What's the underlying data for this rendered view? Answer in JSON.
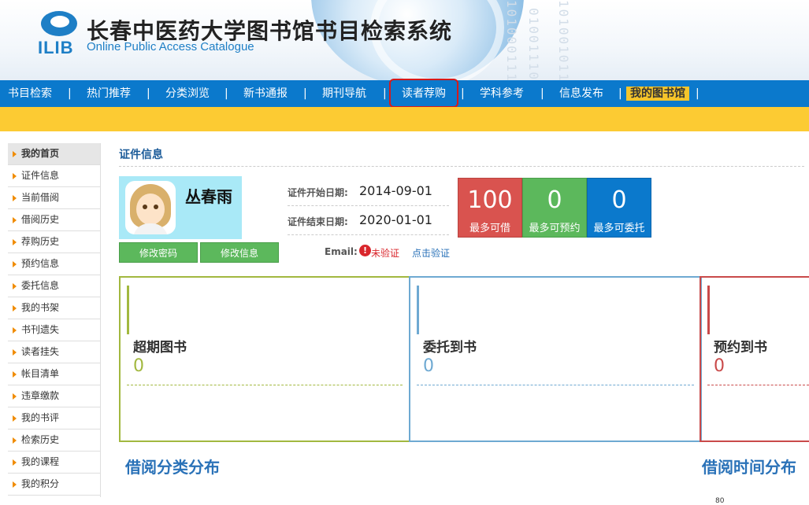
{
  "header": {
    "logo_text": "ILIB",
    "title": "长春中医药大学图书馆书目检索系统",
    "subtitle": "Online Public Access Catalogue"
  },
  "nav": {
    "items": [
      "书目检索",
      "热门推荐",
      "分类浏览",
      "新书通报",
      "期刊导航",
      "读者荐购",
      "学科参考",
      "信息发布",
      "我的图书馆"
    ],
    "separator": "|"
  },
  "sidebar": {
    "items": [
      "我的首页",
      "证件信息",
      "当前借阅",
      "借阅历史",
      "荐购历史",
      "预约信息",
      "委托信息",
      "我的书架",
      "书刊遗失",
      "读者挂失",
      "帐目清单",
      "违章缴款",
      "我的书评",
      "检索历史",
      "我的课程",
      "我的积分"
    ]
  },
  "profile": {
    "section_title": "证件信息",
    "name": "丛春雨",
    "start_label": "证件开始日期:",
    "start_date": "2014-09-01",
    "end_label": "证件结束日期:",
    "end_date": "2020-01-01",
    "change_password": "修改密码",
    "edit_info": "修改信息",
    "email_label": "Email:",
    "email_icon": "!",
    "email_status": "未验证",
    "email_verify": "点击验证"
  },
  "stats": [
    {
      "value": "100",
      "label": "最多可借",
      "color": "#d9534f"
    },
    {
      "value": "0",
      "label": "最多可预约",
      "color": "#5cb85c"
    },
    {
      "value": "0",
      "label": "最多可委托",
      "color": "#0b79cc"
    }
  ],
  "cards": [
    {
      "title": "超期图书",
      "value": "0",
      "color": "#a2b83f"
    },
    {
      "title": "委托到书",
      "value": "0",
      "color": "#6ea9d2"
    },
    {
      "title": "预约到书",
      "value": "0",
      "color": "#c94a4a"
    }
  ],
  "charts": {
    "category_title": "借阅分类分布",
    "time_title": "借阅时间分布",
    "axis_tick": "80"
  }
}
